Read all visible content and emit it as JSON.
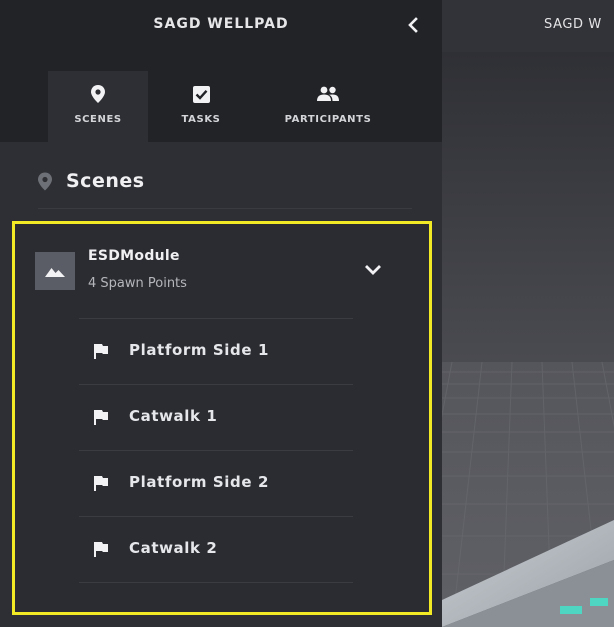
{
  "panel": {
    "title": "SAGD WELLPAD",
    "collapse_icon": "chevron-left-icon"
  },
  "tabs": [
    {
      "label": "SCENES",
      "icon": "map-pin-icon",
      "active": true
    },
    {
      "label": "TASKS",
      "icon": "checkbox-icon",
      "active": false
    },
    {
      "label": "PARTICIPANTS",
      "icon": "people-icon",
      "active": false
    }
  ],
  "scenes": {
    "heading": "Scenes",
    "module": {
      "name": "ESDModule",
      "subtitle": "4 Spawn Points",
      "thumb_icon": "landscape-icon",
      "expanded": true,
      "spawn_points": [
        {
          "label": "Platform Side 1"
        },
        {
          "label": "Catwalk 1"
        },
        {
          "label": "Platform Side 2"
        },
        {
          "label": "Catwalk 2"
        }
      ]
    }
  },
  "viewport": {
    "title": "SAGD W"
  },
  "colors": {
    "highlight": "#f1ea24",
    "panel_bg": "#2e2f34",
    "header_bg": "#222327"
  }
}
